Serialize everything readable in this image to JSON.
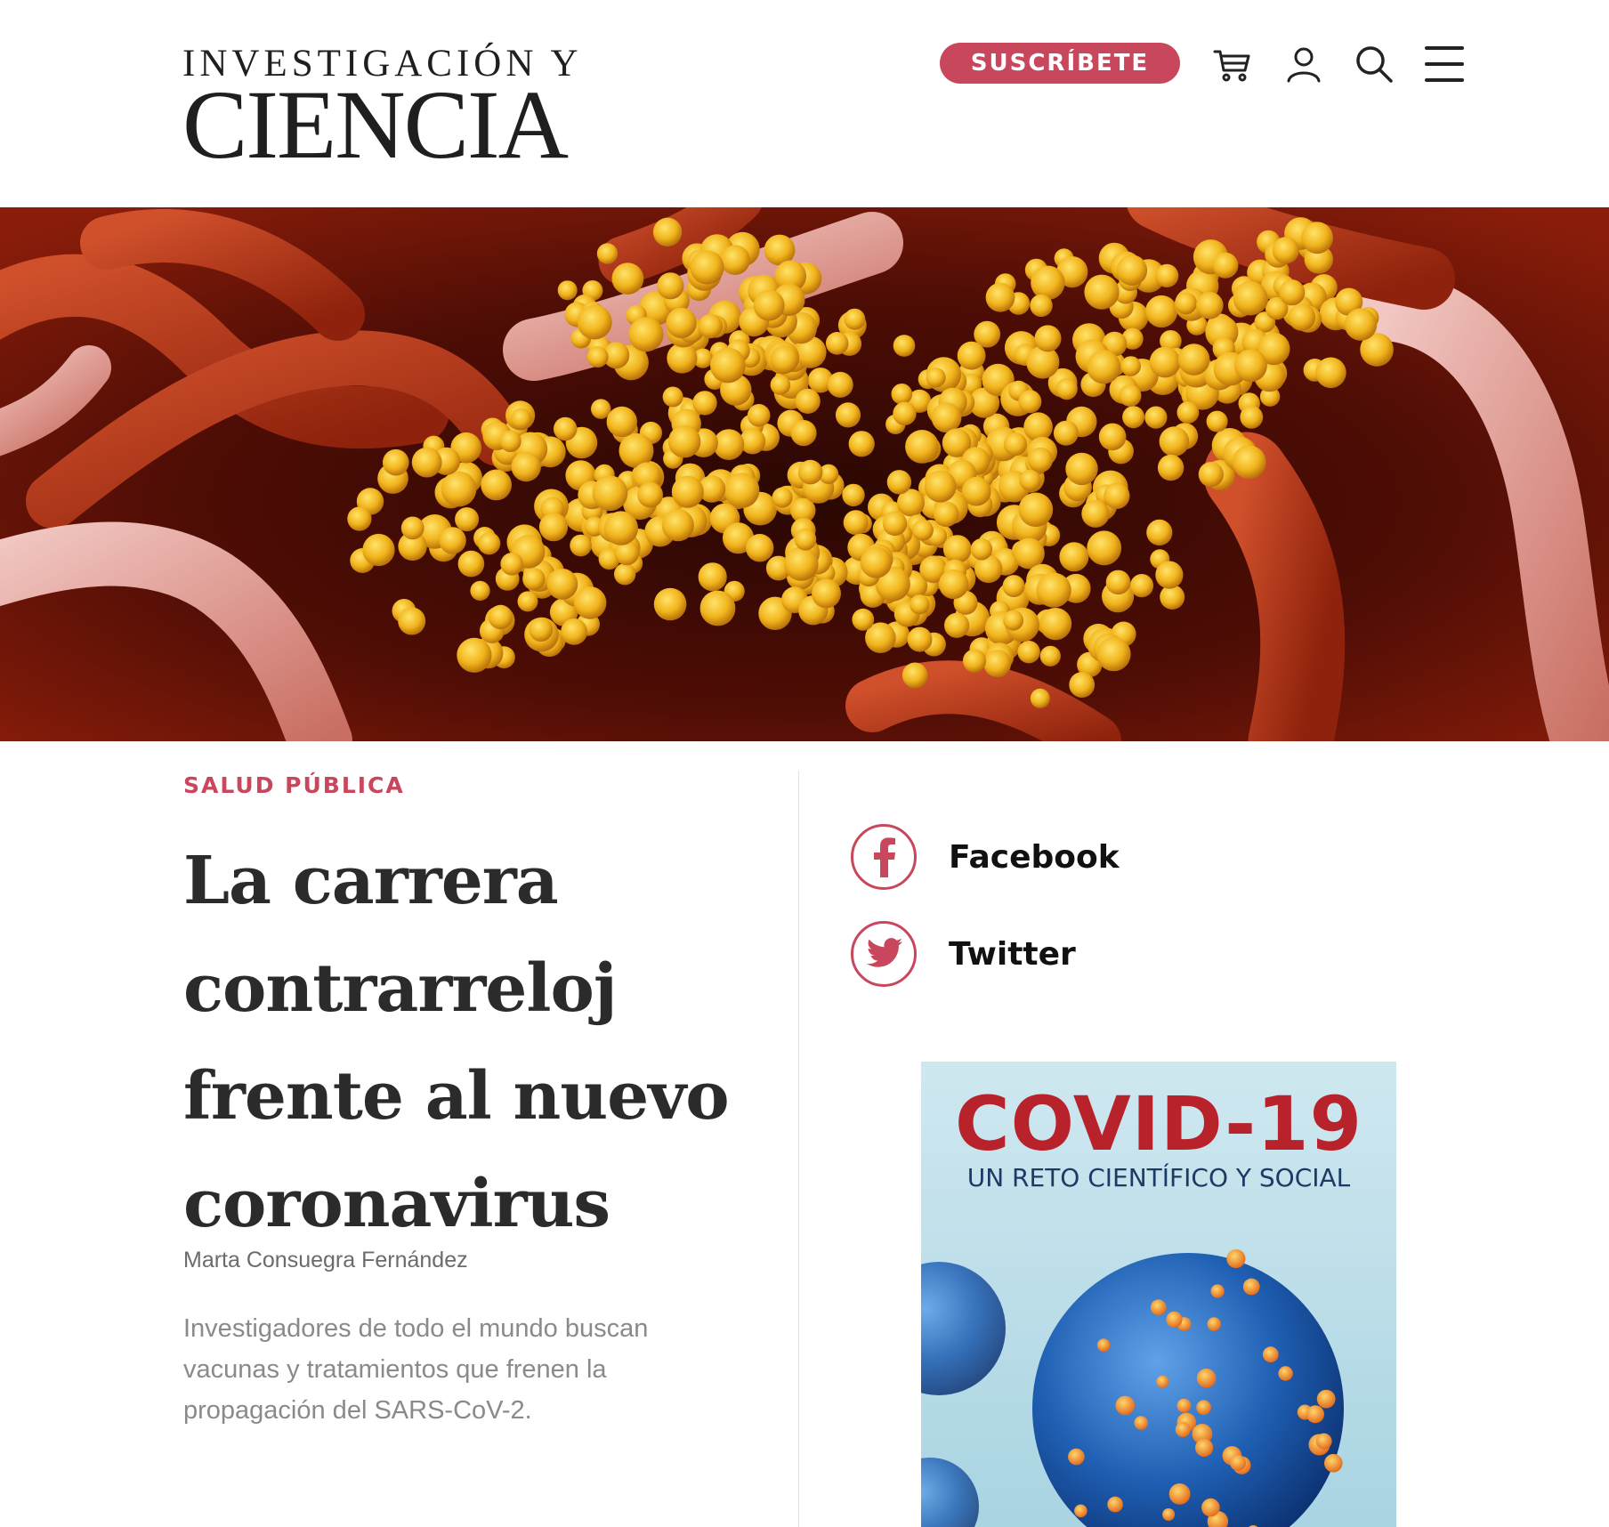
{
  "header": {
    "logo_line1": "INVESTIGACIÓN Y",
    "logo_line2": "CIENCIA",
    "subscribe_label": "SUSCRÍBETE",
    "icons": [
      "cart-icon",
      "user-icon",
      "search-icon",
      "menu-icon"
    ]
  },
  "hero": {
    "image": "coronavirus-microscopy-image"
  },
  "article": {
    "category": "SALUD PÚBLICA",
    "title": "La carrera contrarreloj frente al nuevo coronavirus",
    "author": "Marta Consuegra Fernández",
    "summary": "Investigadores de todo el mundo buscan vacunas y tratamientos que frenen la propagación del SARS-CoV-2."
  },
  "share": {
    "facebook_label": "Facebook",
    "twitter_label": "Twitter"
  },
  "book": {
    "title": "COVID-19",
    "subtitle": "UN RETO CIENTÍFICO Y SOCIAL"
  },
  "colors": {
    "accent": "#c9475c",
    "text_dark": "#2b2b2b",
    "text_muted": "#8a8a8a",
    "cover_bg": "#bfe0ea",
    "cover_title": "#b8222b"
  }
}
